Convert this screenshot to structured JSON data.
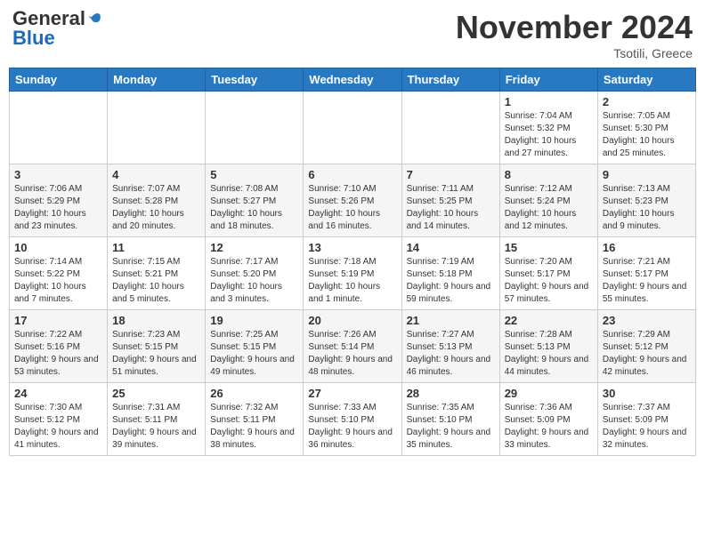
{
  "header": {
    "logo_general": "General",
    "logo_blue": "Blue",
    "month_year": "November 2024",
    "location": "Tsotili, Greece"
  },
  "days_of_week": [
    "Sunday",
    "Monday",
    "Tuesday",
    "Wednesday",
    "Thursday",
    "Friday",
    "Saturday"
  ],
  "weeks": [
    [
      {
        "day": "",
        "info": ""
      },
      {
        "day": "",
        "info": ""
      },
      {
        "day": "",
        "info": ""
      },
      {
        "day": "",
        "info": ""
      },
      {
        "day": "",
        "info": ""
      },
      {
        "day": "1",
        "info": "Sunrise: 7:04 AM\nSunset: 5:32 PM\nDaylight: 10 hours and 27 minutes."
      },
      {
        "day": "2",
        "info": "Sunrise: 7:05 AM\nSunset: 5:30 PM\nDaylight: 10 hours and 25 minutes."
      }
    ],
    [
      {
        "day": "3",
        "info": "Sunrise: 7:06 AM\nSunset: 5:29 PM\nDaylight: 10 hours and 23 minutes."
      },
      {
        "day": "4",
        "info": "Sunrise: 7:07 AM\nSunset: 5:28 PM\nDaylight: 10 hours and 20 minutes."
      },
      {
        "day": "5",
        "info": "Sunrise: 7:08 AM\nSunset: 5:27 PM\nDaylight: 10 hours and 18 minutes."
      },
      {
        "day": "6",
        "info": "Sunrise: 7:10 AM\nSunset: 5:26 PM\nDaylight: 10 hours and 16 minutes."
      },
      {
        "day": "7",
        "info": "Sunrise: 7:11 AM\nSunset: 5:25 PM\nDaylight: 10 hours and 14 minutes."
      },
      {
        "day": "8",
        "info": "Sunrise: 7:12 AM\nSunset: 5:24 PM\nDaylight: 10 hours and 12 minutes."
      },
      {
        "day": "9",
        "info": "Sunrise: 7:13 AM\nSunset: 5:23 PM\nDaylight: 10 hours and 9 minutes."
      }
    ],
    [
      {
        "day": "10",
        "info": "Sunrise: 7:14 AM\nSunset: 5:22 PM\nDaylight: 10 hours and 7 minutes."
      },
      {
        "day": "11",
        "info": "Sunrise: 7:15 AM\nSunset: 5:21 PM\nDaylight: 10 hours and 5 minutes."
      },
      {
        "day": "12",
        "info": "Sunrise: 7:17 AM\nSunset: 5:20 PM\nDaylight: 10 hours and 3 minutes."
      },
      {
        "day": "13",
        "info": "Sunrise: 7:18 AM\nSunset: 5:19 PM\nDaylight: 10 hours and 1 minute."
      },
      {
        "day": "14",
        "info": "Sunrise: 7:19 AM\nSunset: 5:18 PM\nDaylight: 9 hours and 59 minutes."
      },
      {
        "day": "15",
        "info": "Sunrise: 7:20 AM\nSunset: 5:17 PM\nDaylight: 9 hours and 57 minutes."
      },
      {
        "day": "16",
        "info": "Sunrise: 7:21 AM\nSunset: 5:17 PM\nDaylight: 9 hours and 55 minutes."
      }
    ],
    [
      {
        "day": "17",
        "info": "Sunrise: 7:22 AM\nSunset: 5:16 PM\nDaylight: 9 hours and 53 minutes."
      },
      {
        "day": "18",
        "info": "Sunrise: 7:23 AM\nSunset: 5:15 PM\nDaylight: 9 hours and 51 minutes."
      },
      {
        "day": "19",
        "info": "Sunrise: 7:25 AM\nSunset: 5:15 PM\nDaylight: 9 hours and 49 minutes."
      },
      {
        "day": "20",
        "info": "Sunrise: 7:26 AM\nSunset: 5:14 PM\nDaylight: 9 hours and 48 minutes."
      },
      {
        "day": "21",
        "info": "Sunrise: 7:27 AM\nSunset: 5:13 PM\nDaylight: 9 hours and 46 minutes."
      },
      {
        "day": "22",
        "info": "Sunrise: 7:28 AM\nSunset: 5:13 PM\nDaylight: 9 hours and 44 minutes."
      },
      {
        "day": "23",
        "info": "Sunrise: 7:29 AM\nSunset: 5:12 PM\nDaylight: 9 hours and 42 minutes."
      }
    ],
    [
      {
        "day": "24",
        "info": "Sunrise: 7:30 AM\nSunset: 5:12 PM\nDaylight: 9 hours and 41 minutes."
      },
      {
        "day": "25",
        "info": "Sunrise: 7:31 AM\nSunset: 5:11 PM\nDaylight: 9 hours and 39 minutes."
      },
      {
        "day": "26",
        "info": "Sunrise: 7:32 AM\nSunset: 5:11 PM\nDaylight: 9 hours and 38 minutes."
      },
      {
        "day": "27",
        "info": "Sunrise: 7:33 AM\nSunset: 5:10 PM\nDaylight: 9 hours and 36 minutes."
      },
      {
        "day": "28",
        "info": "Sunrise: 7:35 AM\nSunset: 5:10 PM\nDaylight: 9 hours and 35 minutes."
      },
      {
        "day": "29",
        "info": "Sunrise: 7:36 AM\nSunset: 5:09 PM\nDaylight: 9 hours and 33 minutes."
      },
      {
        "day": "30",
        "info": "Sunrise: 7:37 AM\nSunset: 5:09 PM\nDaylight: 9 hours and 32 minutes."
      }
    ]
  ]
}
